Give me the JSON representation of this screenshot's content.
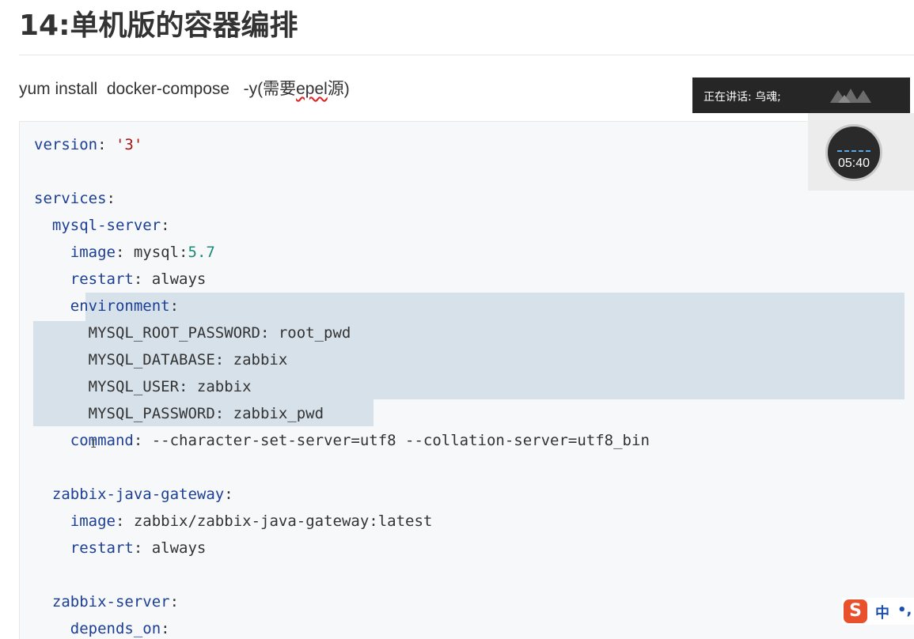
{
  "page": {
    "title": "14:单机版的容器编排",
    "command": {
      "prefix": "yum install  docker-compose   -y(需要",
      "underlined": "epel",
      "suffix": "源)"
    }
  },
  "overlay": {
    "speaking_label": "正在讲话: 乌魂;",
    "timer": "05:40"
  },
  "ime": {
    "logo": "S",
    "mode": "中",
    "punct": "•,"
  },
  "code": {
    "lines": [
      {
        "k": "version",
        "p": ": ",
        "s": "'3'"
      },
      {},
      {
        "k": "services",
        "p": ":"
      },
      {
        "indent": "  ",
        "k": "mysql-server",
        "p": ":"
      },
      {
        "indent": "    ",
        "k": "image",
        "p": ": ",
        "v": "mysql:",
        "n": "5.7"
      },
      {
        "indent": "    ",
        "k": "restart",
        "p": ": ",
        "v": "always"
      },
      {
        "indent": "    ",
        "k": "environment",
        "p": ":"
      },
      {
        "indent": "      ",
        "v": "MYSQL_ROOT_PASSWORD: root_pwd"
      },
      {
        "indent": "      ",
        "v": "MYSQL_DATABASE: zabbix"
      },
      {
        "indent": "      ",
        "v": "MYSQL_USER: zabbix"
      },
      {
        "indent": "      ",
        "v": "MYSQL_PASSWORD: zabbix_pwd"
      },
      {
        "indent": "    ",
        "k": "command",
        "p": ": ",
        "v": "--character-set-server=utf8 --collation-server=utf8_bin"
      },
      {},
      {
        "indent": "  ",
        "k": "zabbix-java-gateway",
        "p": ":"
      },
      {
        "indent": "    ",
        "k": "image",
        "p": ": ",
        "v": "zabbix/zabbix-java-gateway:latest"
      },
      {
        "indent": "    ",
        "k": "restart",
        "p": ": ",
        "v": "always"
      },
      {},
      {
        "indent": "  ",
        "k": "zabbix-server",
        "p": ":"
      },
      {
        "indent": "    ",
        "k": "depends_on",
        "p": ":"
      }
    ]
  },
  "colors": {
    "key": "#1c3f95",
    "string": "#aa1111",
    "number": "#1a8a7a",
    "selection": "#d6e1ea",
    "code_bg": "#f6f8fa"
  }
}
